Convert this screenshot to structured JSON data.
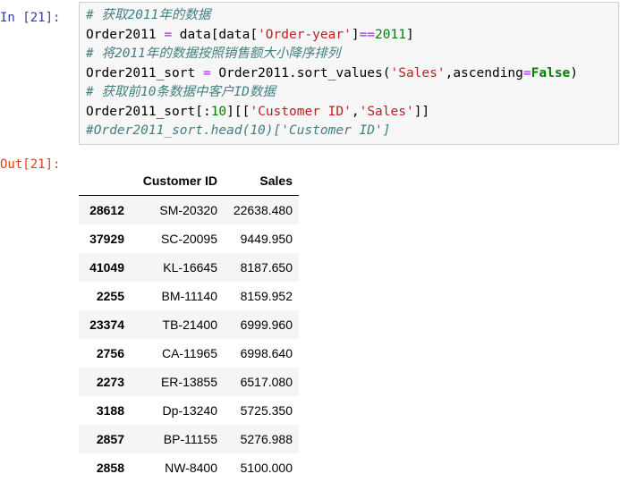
{
  "cell": {
    "in_prompt": "In  [21]:",
    "out_prompt": "Out[21]:",
    "code": [
      [
        {
          "t": "# 获取2011年的数据",
          "c": "c-comment"
        }
      ],
      [
        {
          "t": "Order2011 ",
          "c": ""
        },
        {
          "t": "=",
          "c": "c-op"
        },
        {
          "t": " data[data[",
          "c": ""
        },
        {
          "t": "'Order-year'",
          "c": "c-str"
        },
        {
          "t": "]",
          "c": ""
        },
        {
          "t": "==",
          "c": "c-op"
        },
        {
          "t": "2011",
          "c": "c-num"
        },
        {
          "t": "]",
          "c": ""
        }
      ],
      [
        {
          "t": "# 将2011年的数据按照销售额大小降序排列",
          "c": "c-comment"
        }
      ],
      [
        {
          "t": "Order2011_sort ",
          "c": ""
        },
        {
          "t": "=",
          "c": "c-op"
        },
        {
          "t": " Order2011.sort_values(",
          "c": ""
        },
        {
          "t": "'Sales'",
          "c": "c-str"
        },
        {
          "t": ",ascending",
          "c": ""
        },
        {
          "t": "=",
          "c": "c-op"
        },
        {
          "t": "False",
          "c": "c-kw"
        },
        {
          "t": ")",
          "c": ""
        }
      ],
      [
        {
          "t": "# 获取前10条数据中客户ID数据",
          "c": "c-comment"
        }
      ],
      [
        {
          "t": "Order2011_sort[:",
          "c": ""
        },
        {
          "t": "10",
          "c": "c-num"
        },
        {
          "t": "][[",
          "c": ""
        },
        {
          "t": "'Customer ID'",
          "c": "c-str"
        },
        {
          "t": ",",
          "c": ""
        },
        {
          "t": "'Sales'",
          "c": "c-str"
        },
        {
          "t": "]]",
          "c": ""
        }
      ],
      [
        {
          "t": "#Order2011_sort.head(10)['Customer ID']",
          "c": "c-comment"
        }
      ]
    ]
  },
  "table": {
    "columns": [
      "",
      "Customer ID",
      "Sales"
    ],
    "rows": [
      {
        "index": "28612",
        "customer_id": "SM-20320",
        "sales": "22638.480"
      },
      {
        "index": "37929",
        "customer_id": "SC-20095",
        "sales": "9449.950"
      },
      {
        "index": "41049",
        "customer_id": "KL-16645",
        "sales": "8187.650"
      },
      {
        "index": "2255",
        "customer_id": "BM-11140",
        "sales": "8159.952"
      },
      {
        "index": "23374",
        "customer_id": "TB-21400",
        "sales": "6999.960"
      },
      {
        "index": "2756",
        "customer_id": "CA-11965",
        "sales": "6998.640"
      },
      {
        "index": "2273",
        "customer_id": "ER-13855",
        "sales": "6517.080"
      },
      {
        "index": "3188",
        "customer_id": "Dp-13240",
        "sales": "5725.350"
      },
      {
        "index": "2857",
        "customer_id": "BP-11155",
        "sales": "5276.988"
      },
      {
        "index": "2858",
        "customer_id": "NW-8400",
        "sales": "5100.000"
      }
    ]
  }
}
